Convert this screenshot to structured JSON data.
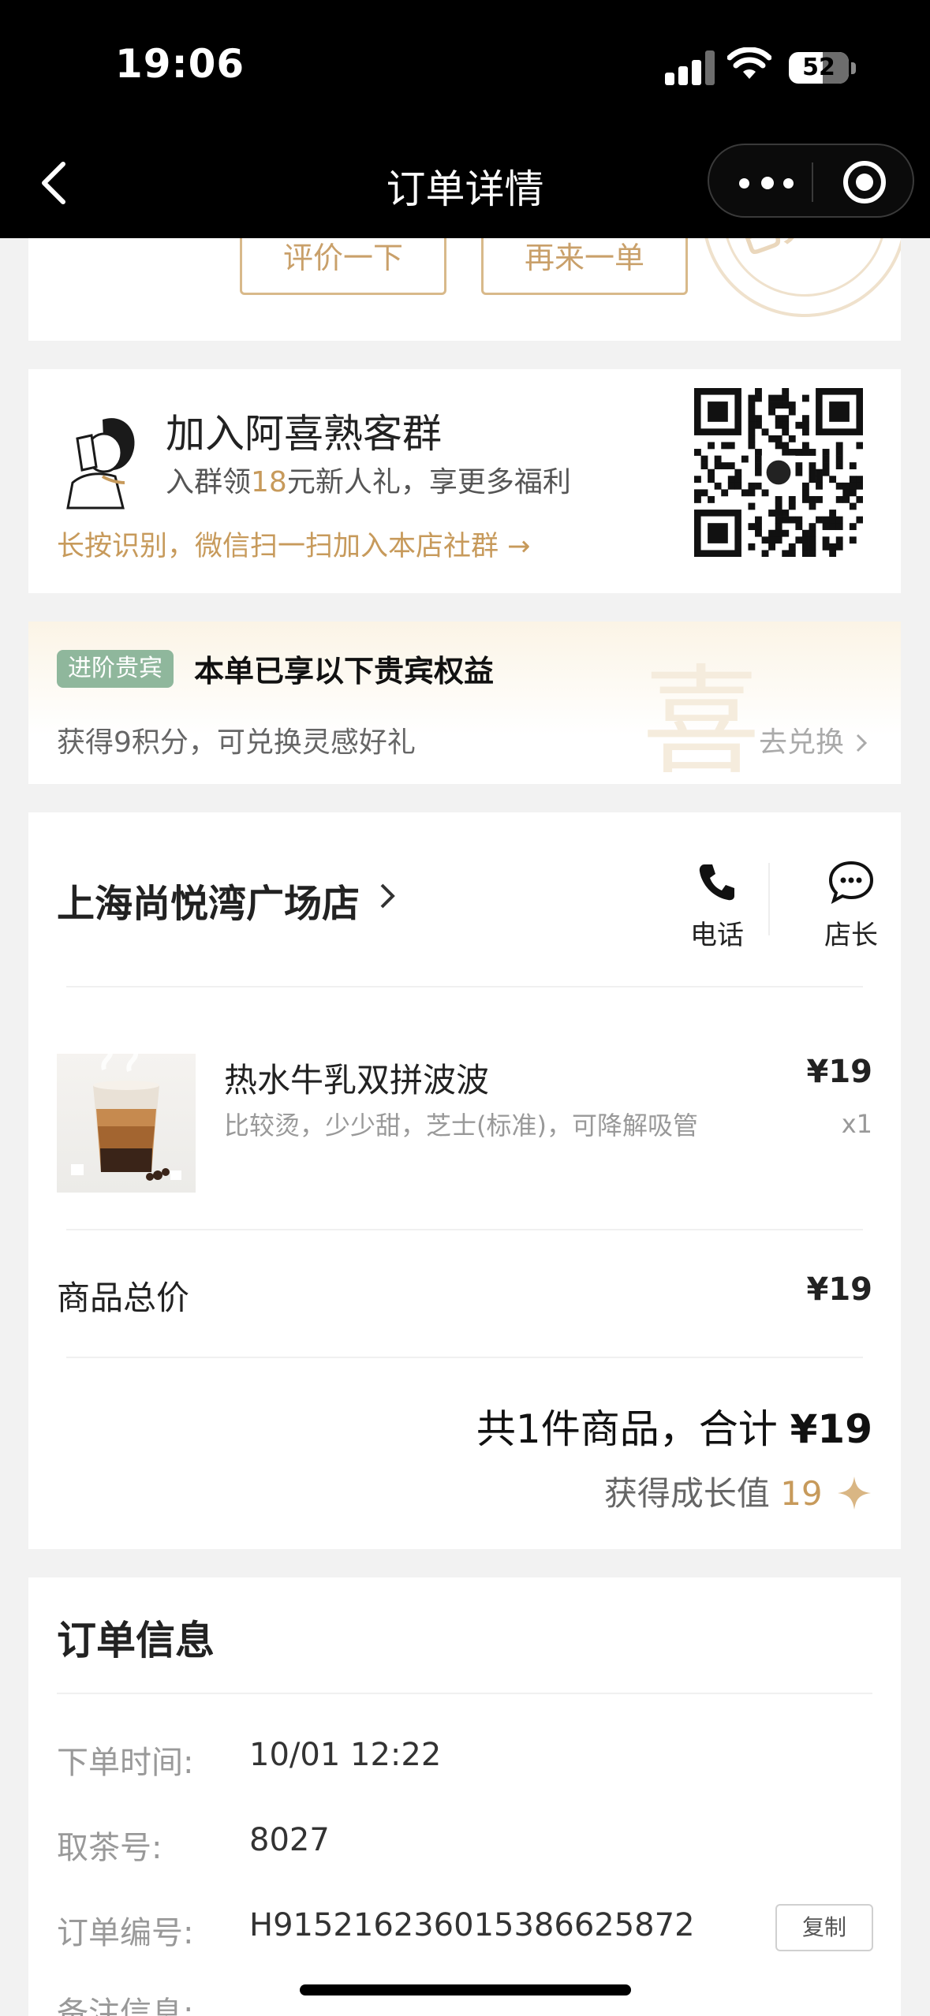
{
  "status_bar": {
    "time": "19:06",
    "battery": "52"
  },
  "nav": {
    "title": "订单详情"
  },
  "top_actions": {
    "review_label": "评价一下",
    "reorder_label": "再来一单",
    "stamp_text": "已完成"
  },
  "group": {
    "title": "加入阿喜熟客群",
    "sub_prefix": "入群领",
    "sub_highlight": "18",
    "sub_suffix": "元新人礼，享更多福利",
    "link": "长按识别，微信扫一扫加入本店社群 →"
  },
  "vip": {
    "badge": "进阶贵宾",
    "title": "本单已享以下贵宾权益",
    "subtitle": "获得9积分，可兑换灵感好礼",
    "link": "去兑换",
    "watermark": "喜"
  },
  "order": {
    "store_name": "上海尚悦湾广场店",
    "call_label": "电话",
    "manager_label": "店长",
    "product": {
      "name": "热水牛乳双拼波波",
      "options": "比较烫，少少甜，芝士(标准)，可降解吸管",
      "price": "¥19",
      "qty": "x1"
    },
    "subtotal_label": "商品总价",
    "subtotal_value": "¥19",
    "summary_prefix": "共1件商品，合计 ",
    "summary_amount": "¥19",
    "growth_prefix": "获得成长值 ",
    "growth_value": "19"
  },
  "info": {
    "title": "订单信息",
    "rows": [
      {
        "key": "下单时间:",
        "value": "10/01 12:22"
      },
      {
        "key": "取茶号:",
        "value": "8027"
      },
      {
        "key": "订单编号:",
        "value": "H915216236015386625872"
      },
      {
        "key": "备注信息:",
        "value": ""
      }
    ],
    "copy_label": "复制"
  },
  "colors": {
    "accent_gold": "#c79a5b",
    "vip_green": "#8fb79c",
    "header_bg": "#000000"
  }
}
